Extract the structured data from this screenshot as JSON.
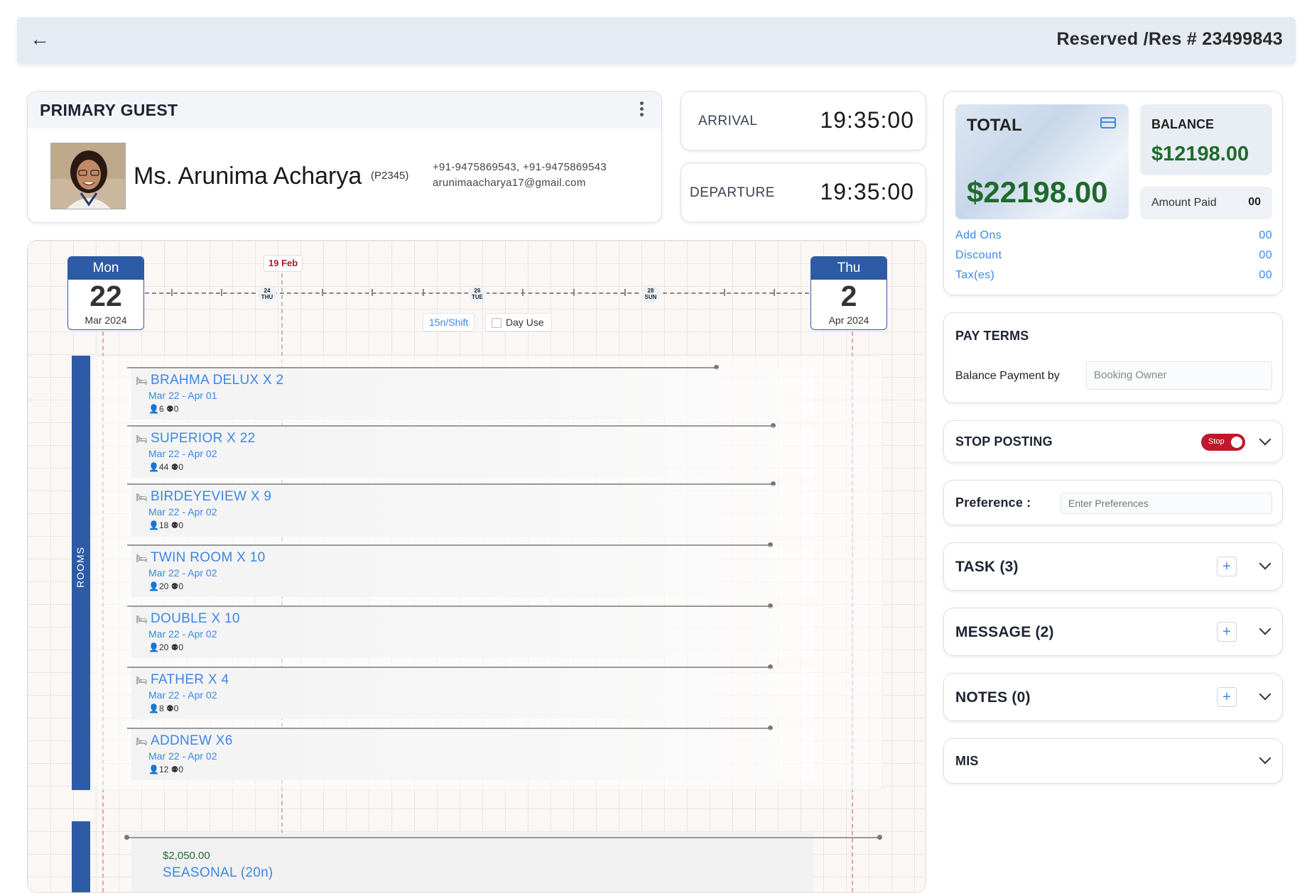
{
  "header": {
    "back_icon": "arrow-left-icon",
    "title": "Reserved /Res # 23499843"
  },
  "guest": {
    "section_title": "PRIMARY GUEST",
    "name": "Ms. Arunima Acharya",
    "code": "(P2345)",
    "phones": "+91-9475869543,  +91-9475869543",
    "email": "arunimaacharya17@gmail.com"
  },
  "stay": {
    "arrival_label": "ARRIVAL",
    "arrival_time": "19:35:00",
    "departure_label": "DEPARTURE",
    "departure_time": "19:35:00"
  },
  "totals": {
    "total_label": "TOTAL",
    "total_value": "$22198.00",
    "balance_label": "BALANCE",
    "balance_value": "$12198.00",
    "paid_label": "Amount Paid",
    "paid_value": "00",
    "rows": [
      {
        "label": "Add Ons",
        "value": "00"
      },
      {
        "label": "Discount",
        "value": "00"
      },
      {
        "label": "Tax(es)",
        "value": "00"
      }
    ],
    "colors": {
      "money": "#1f6a2b",
      "link": "#3d86e6"
    }
  },
  "pay_terms": {
    "title": "PAY TERMS",
    "label": "Balance Payment by",
    "value": "Booking Owner"
  },
  "stop_posting": {
    "title": "STOP POSTING",
    "toggle_label": "Stop",
    "toggle_on": true,
    "toggle_color": "#c0172a"
  },
  "preference": {
    "title": "Preference :",
    "placeholder": "Enter Preferences"
  },
  "task": {
    "title": "TASK (3)"
  },
  "message": {
    "title": "MESSAGE (2)"
  },
  "notes": {
    "title": "NOTES (0)"
  },
  "mis": {
    "title": "MIS"
  },
  "timeline": {
    "start": {
      "dow": "Mon",
      "day": "22",
      "month": "Mar 2024"
    },
    "end": {
      "dow": "Thu",
      "day": "2",
      "month": "Apr 2024"
    },
    "marker": "19 Feb",
    "days": [
      {
        "d": "24",
        "w": "THU"
      },
      {
        "d": "26",
        "w": "TUE"
      },
      {
        "d": "28",
        "w": "SUN"
      }
    ],
    "shift_chip": "15n/Shift",
    "day_use": "Day Use",
    "rooms_label": "ROOMS",
    "rooms": [
      {
        "name": "BRAHMA DELUX  X 2",
        "dates": "Mar 22 - Apr 01",
        "adults": "6",
        "kids": "0"
      },
      {
        "name": "SUPERIOR  X 22",
        "dates": "Mar 22 - Apr 02",
        "adults": "44",
        "kids": "0"
      },
      {
        "name": "BIRDEYEVIEW  X 9",
        "dates": "Mar 22 - Apr 02",
        "adults": "18",
        "kids": "0"
      },
      {
        "name": "TWIN ROOM  X 10",
        "dates": "Mar 22 - Apr 02",
        "adults": "20",
        "kids": "0"
      },
      {
        "name": "DOUBLE  X 10",
        "dates": "Mar 22 - Apr 02",
        "adults": "20",
        "kids": "0"
      },
      {
        "name": "FATHER  X 4",
        "dates": "Mar 22 - Apr 02",
        "adults": "8",
        "kids": "0"
      },
      {
        "name": "ADDNEW  X6",
        "dates": "Mar 22 - Apr 02",
        "adults": "12",
        "kids": "0"
      }
    ],
    "rate_price": "$2,050.00",
    "rate_name": "SEASONAL (20n)"
  }
}
